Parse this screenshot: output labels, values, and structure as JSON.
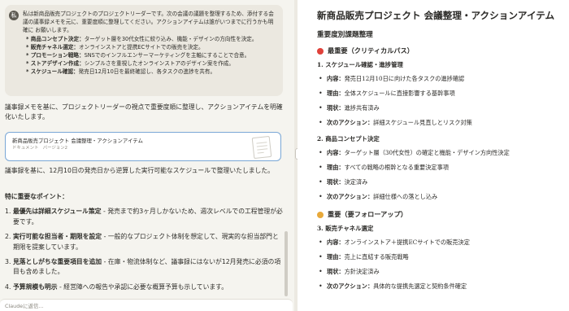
{
  "user_message": {
    "avatar": "私",
    "intro": "私は新商品販売プロジェクトのプロジェクトリーダーです。次の会議の議題を整理するため、添付する会議の議事録メモを元に、重要度順に整理してください。アクションアイテムは誰がいつまでに行うかも明確に お願いします。",
    "bullets": [
      {
        "label": "* 商品コンセプト決定：",
        "text": "ターゲット層を30代女性に絞り込み、機能・デザインの方向性を決定。"
      },
      {
        "label": "* 販売チャネル選定：",
        "text": "オンラインストアと提携ECサイトでの販売を決定。"
      },
      {
        "label": "* プロモーション戦略：",
        "text": "SNSでのインフルエンサーマーケティングを主軸にすることで合意。"
      },
      {
        "label": "* ストアデザイン作成：",
        "text": "シンプルさを重視したオンラインストアのデザイン案を作成。"
      },
      {
        "label": "* スケジュール確認：",
        "text": "発売日12月10日を最終確認し、各タスクの進捗を共有。"
      }
    ]
  },
  "assistant": {
    "reply1": "議事録メモを基に、プロジェクトリーダーの視点で重要度順に整理し、アクションアイテムを明確化いたします。",
    "artifact": {
      "title": "新商品販売プロジェクト 会議整理・アクションアイテム",
      "meta": "ドキュメント　バージョン2"
    },
    "reply2": "議事録を基に、12月10日の発売日から逆算した実行可能なスケジュールで整理いたしました。",
    "points_title": "特に重要なポイント：",
    "points": [
      {
        "num": "1.",
        "label": "最優先は詳細スケジュール策定",
        "text": " - 発売まで約3ヶ月しかないため、週次レベルでの工程管理が必要です。"
      },
      {
        "num": "2.",
        "label": "実行可能な担当者・期限を設定",
        "text": " - 一般的なプロジェクト体制を想定して、現実的な担当部門と期限を提案しています。"
      },
      {
        "num": "3.",
        "label": "見落としがちな重要項目を追加",
        "text": " - 在庫・物流体制など、議事録にはないが12月発売に必須の項目も含めました。"
      },
      {
        "num": "4.",
        "label": "予算規模も明示",
        "text": " - 経営陣への報告や承認に必要な概算予算も示しています。"
      }
    ]
  },
  "input": {
    "placeholder": "Claudeに返信..."
  },
  "document": {
    "title": "新商品販売プロジェクト 会議整理・アクションアイテム",
    "subtitle": "重要度別課題整理",
    "sections": [
      {
        "label": "最重要（クリティカルパス）",
        "color": "#e0413a",
        "items": [
          {
            "title": "1. スケジュール確認・進捗管理",
            "rows": [
              {
                "k": "内容：",
                "v": "発売日12月10日に向けた各タスクの進捗確認"
              },
              {
                "k": "理由：",
                "v": "全体スケジュールに直接影響する基幹事項"
              },
              {
                "k": "現状：",
                "v": "進捗共有済み"
              },
              {
                "k": "次のアクション：",
                "v": "詳細スケジュール見直しとリスク対策"
              }
            ]
          },
          {
            "title": "2. 商品コンセプト決定",
            "rows": [
              {
                "k": "内容：",
                "v": "ターゲット層（30代女性）の確定と機能・デザイン方向性決定"
              },
              {
                "k": "理由：",
                "v": "すべての戦略の根幹となる重要決定事項"
              },
              {
                "k": "現状：",
                "v": "決定済み"
              },
              {
                "k": "次のアクション：",
                "v": "詳細仕様への落とし込み"
              }
            ]
          }
        ]
      },
      {
        "label": "重要（要フォローアップ）",
        "color": "#e8a93a",
        "items": [
          {
            "title": "3. 販売チャネル選定",
            "rows": [
              {
                "k": "内容：",
                "v": "オンラインストア＋提携ECサイトでの販売決定"
              },
              {
                "k": "理由：",
                "v": "売上に直結する販売戦略"
              },
              {
                "k": "現状：",
                "v": "方針決定済み"
              },
              {
                "k": "次のアクション：",
                "v": "具体的な提携先選定と契約条件確定"
              }
            ]
          }
        ]
      }
    ]
  }
}
